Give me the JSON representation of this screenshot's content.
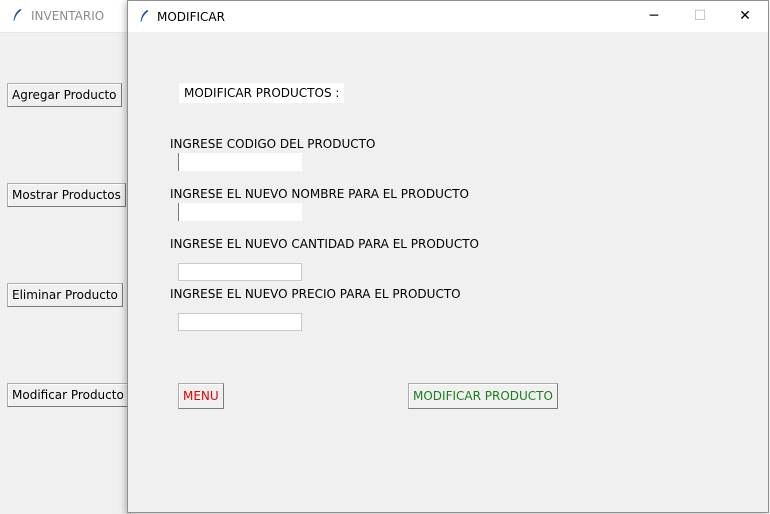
{
  "background_window": {
    "title": "INVENTARIO",
    "buttons": {
      "agregar": "Agregar Producto",
      "mostrar": "Mostrar Productos",
      "eliminar": "Eliminar Producto",
      "modificar": "Modificar Producto"
    }
  },
  "window": {
    "title": "MODIFICAR",
    "controls": {
      "minimize": "─",
      "maximize": "☐",
      "close": "✕"
    }
  },
  "form": {
    "header": "MODIFICAR PRODUCTOS :",
    "fields": {
      "codigo": {
        "label": "INGRESE CODIGO DEL PRODUCTO",
        "value": ""
      },
      "nombre": {
        "label": "INGRESE EL NUEVO NOMBRE PARA EL PRODUCTO",
        "value": ""
      },
      "cantidad": {
        "label": "INGRESE EL NUEVO CANTIDAD PARA EL PRODUCTO",
        "value": ""
      },
      "precio": {
        "label": "INGRESE EL NUEVO PRECIO PARA EL PRODUCTO",
        "value": ""
      }
    },
    "buttons": {
      "menu": "MENU",
      "modificar": "MODIFICAR PRODUCTO"
    }
  },
  "colors": {
    "menu_text": "#e60000",
    "modificar_text": "#1a7f1a"
  }
}
